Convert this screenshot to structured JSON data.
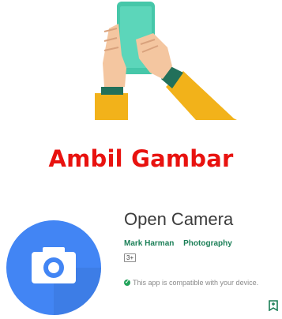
{
  "heading": "Ambil Gambar",
  "app": {
    "name": "Open Camera",
    "developer": "Mark Harman",
    "category": "Photography",
    "content_rating": "3+",
    "compatibility": "This app is compatible with your device."
  },
  "icons": {
    "illustration": "hand-holding-phone-icon",
    "app_icon": "camera-app-icon",
    "compat": "check-circle-icon",
    "wishlist": "bookmark-icon"
  },
  "colors": {
    "heading": "#e8120f",
    "developer_link": "#1b7f57",
    "icon_blue": "#4285f4",
    "compat_green": "#22a35a"
  }
}
